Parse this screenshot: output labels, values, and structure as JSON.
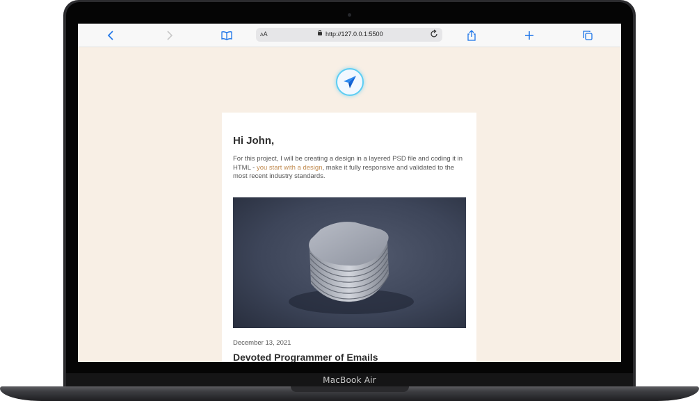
{
  "device": {
    "label": "MacBook Air"
  },
  "browser": {
    "text_size_label": "AA",
    "url": "http://127.0.0.1:5500",
    "icons": [
      "back-icon",
      "forward-icon",
      "bookmarks-icon",
      "lock-icon",
      "reload-icon",
      "share-icon",
      "new-tab-icon",
      "tabs-icon"
    ],
    "accent_color": "#1a73e8"
  },
  "page": {
    "background_color": "#f8efe5",
    "logo_icon": "paper-plane-icon",
    "card": {
      "greeting": "Hi John,",
      "intro_before": "For this project, I will be creating a design in a layered PSD file and coding it in HTML - ",
      "intro_link": "you start with a design",
      "intro_after": ", make it fully responsive and validated to the most recent industry standards.",
      "link_color": "#c08a4e",
      "post": {
        "date": "December 13, 2021",
        "title": "Devoted Programmer of Emails"
      }
    }
  }
}
